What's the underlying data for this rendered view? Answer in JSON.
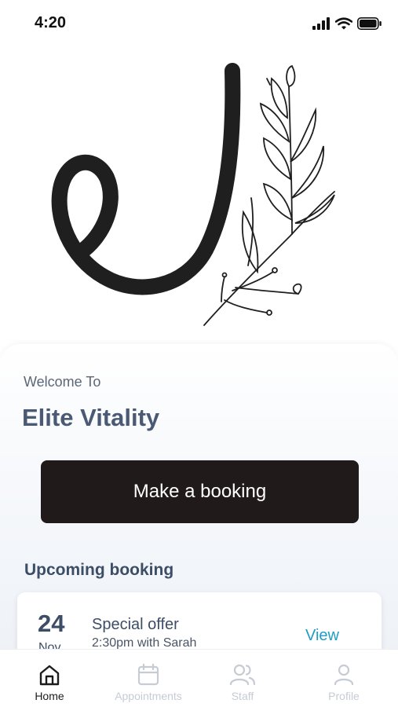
{
  "status_bar": {
    "time": "4:20"
  },
  "home": {
    "welcome_text": "Welcome To",
    "business_name": "Elite Vitality",
    "booking_button_label": "Make a booking"
  },
  "upcoming": {
    "section_title": "Upcoming booking",
    "day": "24",
    "month": "Nov",
    "title": "Special offer",
    "subtitle": "2:30pm with Sarah",
    "view_label": "View"
  },
  "tabs": [
    {
      "label": "Home",
      "icon": "home-icon",
      "active": true
    },
    {
      "label": "Appointments",
      "icon": "calendar-icon",
      "active": false
    },
    {
      "label": "Staff",
      "icon": "users-icon",
      "active": false
    },
    {
      "label": "Profile",
      "icon": "user-icon",
      "active": false
    }
  ],
  "colors": {
    "primary_button": "#201a1a",
    "accent_link": "#1e9dc4",
    "heading": "#4a5a74",
    "tab_inactive": "#c6cbd4"
  }
}
